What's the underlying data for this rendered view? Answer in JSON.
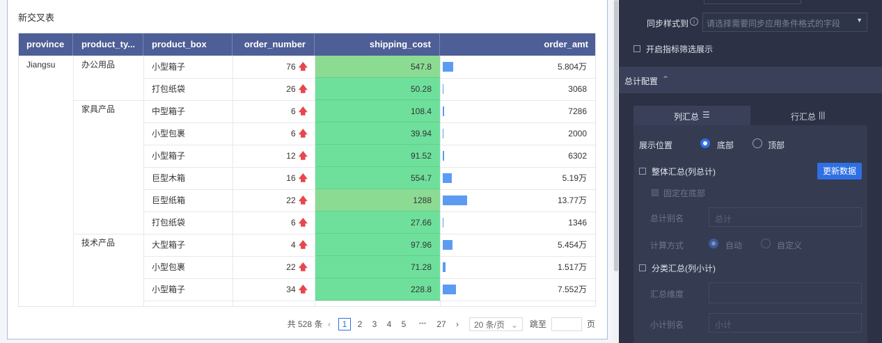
{
  "table": {
    "title": "新交叉表",
    "columns": [
      "province",
      "product_ty...",
      "product_box",
      "order_number",
      "shipping_cost",
      "order_amt"
    ],
    "province_value": "Jiangsu",
    "groups": [
      {
        "label": "办公用品",
        "start": 0
      },
      {
        "label": "家具产品",
        "start": 2
      },
      {
        "label": "技术产品",
        "start": 8
      }
    ],
    "rows": [
      {
        "box": "小型箱子",
        "order_number": "76",
        "shipping_cost": "547.8",
        "order_amt": "5.804万",
        "amt_value": 58040
      },
      {
        "box": "打包纸袋",
        "order_number": "26",
        "shipping_cost": "50.28",
        "order_amt": "3068",
        "amt_value": 3068
      },
      {
        "box": "中型箱子",
        "order_number": "6",
        "shipping_cost": "108.4",
        "order_amt": "7286",
        "amt_value": 7286
      },
      {
        "box": "小型包裹",
        "order_number": "6",
        "shipping_cost": "39.94",
        "order_amt": "2000",
        "amt_value": 2000
      },
      {
        "box": "小型箱子",
        "order_number": "12",
        "shipping_cost": "91.52",
        "order_amt": "6302",
        "amt_value": 6302
      },
      {
        "box": "巨型木箱",
        "order_number": "16",
        "shipping_cost": "554.7",
        "order_amt": "5.19万",
        "amt_value": 51900
      },
      {
        "box": "巨型纸箱",
        "order_number": "22",
        "shipping_cost": "1288",
        "order_amt": "13.77万",
        "amt_value": 137700
      },
      {
        "box": "打包纸袋",
        "order_number": "6",
        "shipping_cost": "27.66",
        "order_amt": "1346",
        "amt_value": 1346
      },
      {
        "box": "大型箱子",
        "order_number": "4",
        "shipping_cost": "97.96",
        "order_amt": "5.454万",
        "amt_value": 54540
      },
      {
        "box": "小型包裹",
        "order_number": "22",
        "shipping_cost": "71.28",
        "order_amt": "1.517万",
        "amt_value": 15170
      },
      {
        "box": "小型箱子",
        "order_number": "34",
        "shipping_cost": "228.8",
        "order_amt": "7.552万",
        "amt_value": 75520
      }
    ],
    "amt_max": 137700,
    "arrow_icon": "arrow-up-icon",
    "colors": {
      "header": "#4e5e96",
      "shipping_green": "#6ee09c",
      "shipping_green_alt": "#8cdb93",
      "bar": "#5b9bf2",
      "arrow": "#e5484d"
    }
  },
  "pagination": {
    "total": "共 528 条",
    "pages": [
      "1",
      "2",
      "3",
      "4",
      "5"
    ],
    "ellipsis": "•••",
    "last_page": "27",
    "current": "1",
    "page_size": "20 条/页",
    "jump_label": "跳至",
    "jump_suffix": "页"
  },
  "panel": {
    "sync_label": "同步样式到",
    "sync_placeholder": "请选择需要同步应用条件格式的字段",
    "filter_label": "开启指标筛选展示",
    "total_section": "总计配置",
    "tab_col": "列汇总",
    "tab_row": "行汇总",
    "position_label": "展示位置",
    "pos_bottom": "底部",
    "pos_top": "顶部",
    "overall_label": "整体汇总(列总计)",
    "update_button": "更新数据",
    "fixed_bottom": "固定在底部",
    "alias_label": "总计别名",
    "alias_placeholder": "总计",
    "calc_label": "计算方式",
    "calc_auto": "自动",
    "calc_custom": "自定义",
    "sub_label": "分类汇总(列小计)",
    "dim_label": "汇总维度",
    "sub_alias_label": "小计别名",
    "sub_alias_placeholder": "小计",
    "accent": "#2f6fe4"
  }
}
